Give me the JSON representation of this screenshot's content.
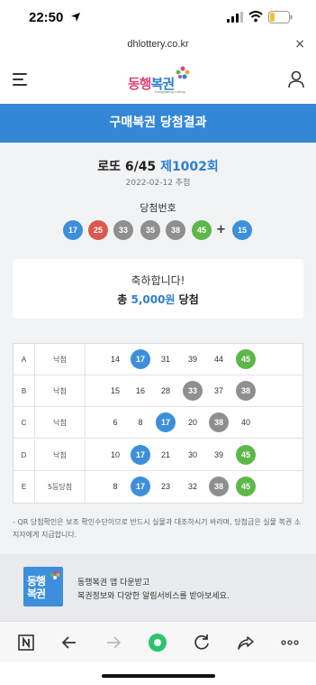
{
  "status_bar": {
    "time": "22:50"
  },
  "browser": {
    "url": "dhlottery.co.kr",
    "close_label": "×"
  },
  "header": {
    "logo_text_pink": "동행",
    "logo_text_blue": "복권",
    "logo_sub": "Donghaeng Lottery"
  },
  "banner": {
    "title": "구매복권 당첨결과"
  },
  "draw": {
    "game": "로또 6/45",
    "round": "제1002회",
    "date": "2022-02-12 추첨",
    "numbers_label": "당첨번호",
    "plus": "+",
    "winning_numbers": [
      {
        "value": "17",
        "color": "blue"
      },
      {
        "value": "25",
        "color": "red"
      },
      {
        "value": "33",
        "color": "gray"
      },
      {
        "value": "35",
        "color": "gray"
      },
      {
        "value": "38",
        "color": "gray"
      },
      {
        "value": "45",
        "color": "green"
      }
    ],
    "bonus_number": {
      "value": "15",
      "color": "blue"
    }
  },
  "result": {
    "congrats": "축하합니다!",
    "prize_prefix": "총",
    "prize_amount": "5,000원",
    "prize_suffix": "당첨"
  },
  "tickets": [
    {
      "id": "A",
      "result": "낙첨",
      "numbers": [
        {
          "value": "14"
        },
        {
          "value": "17",
          "match": "blue"
        },
        {
          "value": "31"
        },
        {
          "value": "39"
        },
        {
          "value": "44"
        },
        {
          "value": "45",
          "match": "green"
        }
      ]
    },
    {
      "id": "B",
      "result": "낙첨",
      "numbers": [
        {
          "value": "15"
        },
        {
          "value": "16"
        },
        {
          "value": "28"
        },
        {
          "value": "33",
          "match": "gray"
        },
        {
          "value": "37"
        },
        {
          "value": "38",
          "match": "gray"
        }
      ]
    },
    {
      "id": "C",
      "result": "낙첨",
      "numbers": [
        {
          "value": "6"
        },
        {
          "value": "8"
        },
        {
          "value": "17",
          "match": "blue"
        },
        {
          "value": "20"
        },
        {
          "value": "38",
          "match": "gray"
        },
        {
          "value": "40"
        }
      ]
    },
    {
      "id": "D",
      "result": "낙첨",
      "numbers": [
        {
          "value": "10"
        },
        {
          "value": "17",
          "match": "blue"
        },
        {
          "value": "21"
        },
        {
          "value": "30"
        },
        {
          "value": "39"
        },
        {
          "value": "45",
          "match": "green"
        }
      ]
    },
    {
      "id": "E",
      "result": "5등당첨",
      "numbers": [
        {
          "value": "8"
        },
        {
          "value": "17",
          "match": "blue"
        },
        {
          "value": "23"
        },
        {
          "value": "32"
        },
        {
          "value": "38",
          "match": "gray"
        },
        {
          "value": "45",
          "match": "green"
        }
      ]
    }
  ],
  "notice": "- QR 당첨확인은 보조 확인수단이므로 반드시 실물과 대조하시기 바라며, 당첨금은 실물 복권 소지자에게 지급합니다.",
  "app_promo": {
    "logo_line1": "동행",
    "logo_line2": "복권",
    "line1": "동행복권 앱 다운받고",
    "line2": "복권정보와 다양한 알림서비스를 받아보세요."
  },
  "toolbar": {
    "icons": [
      "naver-n-icon",
      "back-arrow-icon",
      "forward-arrow-icon",
      "home-green-icon",
      "refresh-icon",
      "share-icon",
      "more-icon"
    ]
  }
}
